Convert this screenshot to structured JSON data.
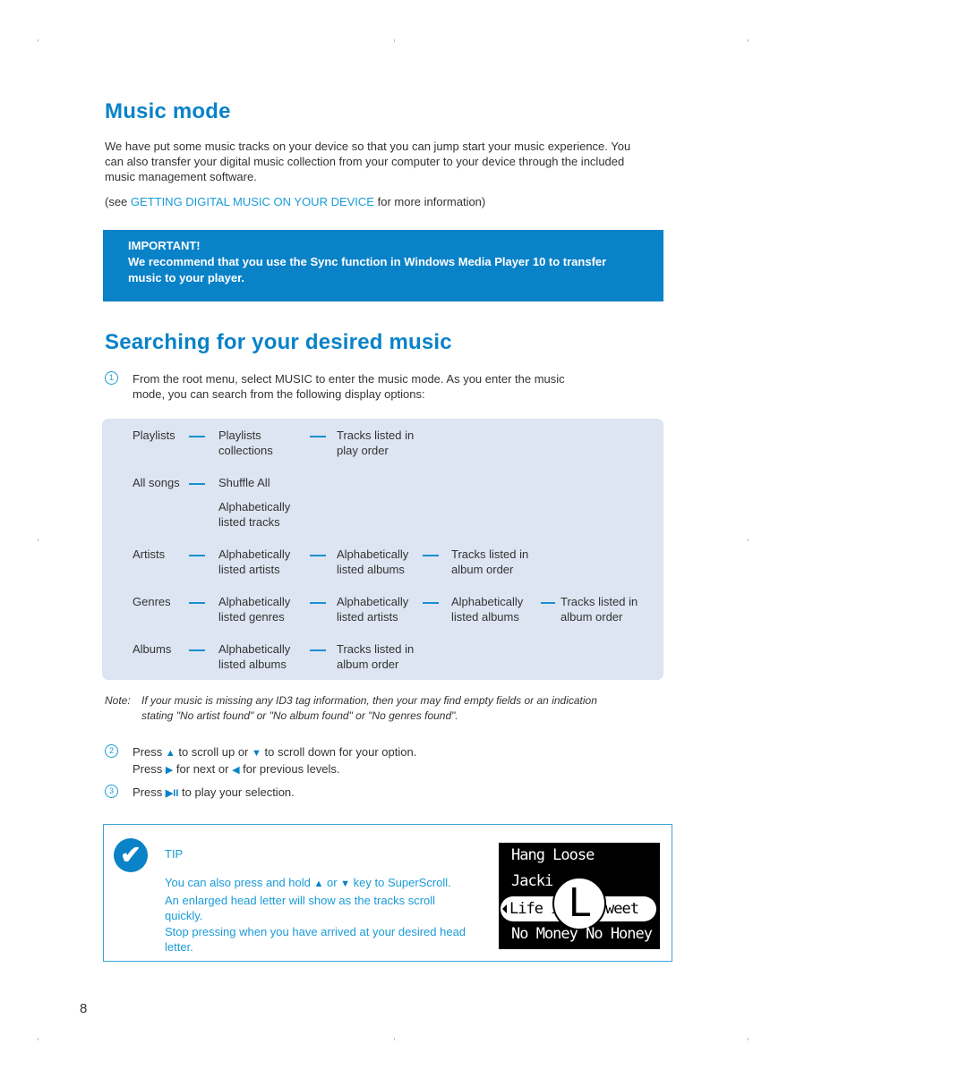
{
  "section1": {
    "title": "Music mode",
    "intro": "We have put some music tracks on your device so that you can jump start your music experience. You can also transfer your digital music collection from your computer to your device through the included music management software.",
    "see_prefix": "(see ",
    "see_link": "GETTING DIGITAL MUSIC ON YOUR DEVICE",
    "see_suffix": " for more information)"
  },
  "important": {
    "label": "IMPORTANT!",
    "text": "We recommend that you use the Sync function in Windows Media Player 10 to transfer music to your player."
  },
  "section2": {
    "title": "Searching for your desired music",
    "step1": {
      "num": "1",
      "text_line1": "From the root menu, select MUSIC to enter the music mode.  As you enter the music",
      "text_line2": "mode, you can search from the following display options:"
    }
  },
  "tree": {
    "rows": [
      {
        "root": "Playlists",
        "levels": [
          [
            "Playlists",
            "collections"
          ],
          [
            "Tracks listed in",
            "play order"
          ]
        ]
      },
      {
        "root": "All songs",
        "levels": [
          [
            "Shuffle All"
          ]
        ],
        "extra": [
          "Alphabetically",
          "listed tracks"
        ]
      },
      {
        "root": "Artists",
        "levels": [
          [
            "Alphabetically",
            "listed artists"
          ],
          [
            "Alphabetically",
            "listed albums"
          ],
          [
            "Tracks listed in",
            "album order"
          ]
        ]
      },
      {
        "root": "Genres",
        "levels": [
          [
            "Alphabetically",
            "listed genres"
          ],
          [
            "Alphabetically",
            "listed artists"
          ],
          [
            "Alphabetically",
            "listed albums"
          ],
          [
            "Tracks listed in",
            "album order"
          ]
        ]
      },
      {
        "root": "Albums",
        "levels": [
          [
            "Alphabetically",
            "listed albums"
          ],
          [
            "Tracks listed in",
            "album order"
          ]
        ]
      }
    ]
  },
  "note": {
    "label": "Note:",
    "line1": "If your music is missing any ID3 tag information, then your may find empty fields or an indication",
    "line2": "stating \"No artist found\" or \"No album found\" or \"No genres found\"."
  },
  "step2": {
    "num": "2",
    "l1_a": "Press ",
    "l1_b": " to scroll up or ",
    "l1_c": " to scroll down for your option.",
    "l2_a": "Press ",
    "l2_b": " for next or ",
    "l2_c": " for previous levels."
  },
  "step3": {
    "num": "3",
    "a": "Press ",
    "b": " to play your selection."
  },
  "icons": {
    "up": "▲",
    "down": "▼",
    "right": "▶",
    "left": "◀",
    "play_pause": "▶II",
    "check": "✔"
  },
  "tip": {
    "title": "TIP",
    "p1_a": "You can also press and hold ",
    "p1_b": " or ",
    "p1_c": " key to SuperScroll.",
    "p2": "An enlarged head letter will show as the tracks scroll quickly.",
    "p3": "Stop pressing when you have arrived at your desired head letter."
  },
  "device_screen": {
    "line1": "Hang Loose",
    "line2": "Jacki",
    "selected_left": "Life is",
    "selected_right": "weet",
    "letter": "L",
    "line4": "No Money No Honey"
  },
  "page_number": "8"
}
